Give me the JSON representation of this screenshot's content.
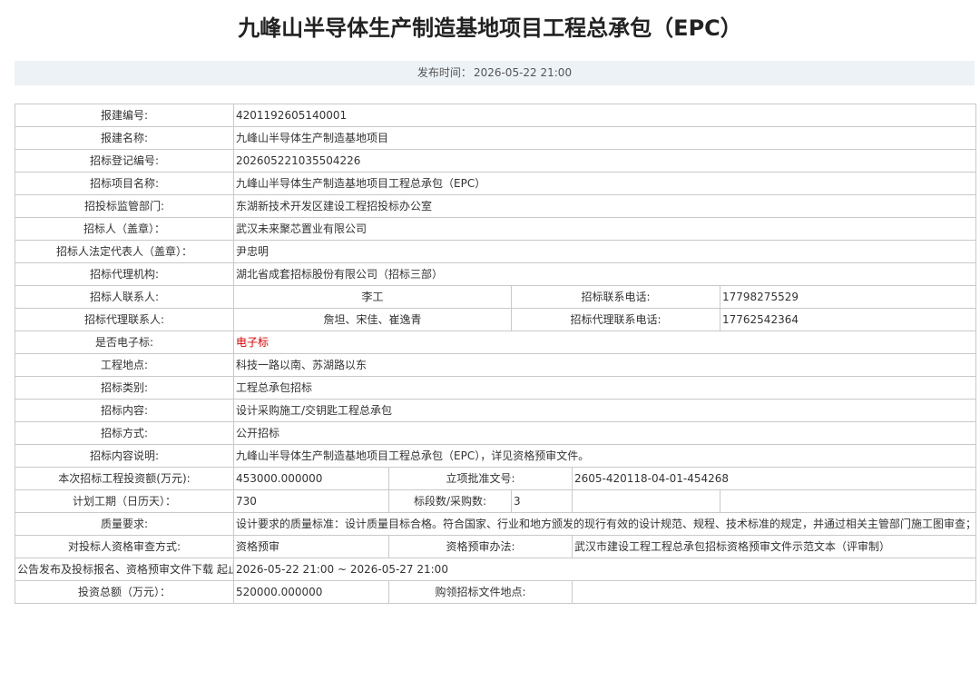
{
  "title": "九峰山半导体生产制造基地项目工程总承包（EPC）",
  "publish": {
    "label": "发布时间：",
    "value": "2026-05-22 21:00"
  },
  "rows": {
    "baojian_no": {
      "label": "报建编号:",
      "value": "4201192605140001"
    },
    "baojian_name": {
      "label": "报建名称:",
      "value": "九峰山半导体生产制造基地项目"
    },
    "zb_reg_no": {
      "label": "招标登记编号:",
      "value": "202605221035504226"
    },
    "zb_project_name": {
      "label": "招标项目名称:",
      "value": "九峰山半导体生产制造基地项目工程总承包（EPC）"
    },
    "supervisor": {
      "label": "招投标监管部门:",
      "value": "东湖新技术开发区建设工程招投标办公室"
    },
    "tenderer": {
      "label": "招标人（盖章）：",
      "value": "武汉未来聚芯置业有限公司"
    },
    "legal_rep": {
      "label": "招标人法定代表人（盖章）：",
      "value": "尹忠明"
    },
    "agency": {
      "label": "招标代理机构:",
      "value": "湖北省成套招标股份有限公司（招标三部）"
    },
    "contact": {
      "label": "招标人联系人:",
      "value": "李工",
      "phone_label": "招标联系电话:",
      "phone": "17798275529"
    },
    "agency_contact": {
      "label": "招标代理联系人:",
      "value": "詹坦、宋佳、崔逸青",
      "phone_label": "招标代理联系电话:",
      "phone": "17762542364"
    },
    "electronic": {
      "label": "是否电子标:",
      "value": "电子标"
    },
    "location": {
      "label": "工程地点:",
      "value": "科技一路以南、苏湖路以东"
    },
    "category": {
      "label": "招标类别:",
      "value": "工程总承包招标"
    },
    "content": {
      "label": "招标内容:",
      "value": "设计采购施工/交钥匙工程总承包"
    },
    "method": {
      "label": "招标方式:",
      "value": "公开招标"
    },
    "description": {
      "label": "招标内容说明:",
      "value": "九峰山半导体生产制造基地项目工程总承包（EPC），详见资格预审文件。"
    },
    "investment": {
      "label": "本次招标工程投资额(万元):",
      "value": "453000.000000",
      "approval_label": "立项批准文号:",
      "approval": "2605-420118-04-01-454268"
    },
    "duration": {
      "label": "计划工期（日历天）：",
      "value": "730",
      "sections_label": "标段数/采购数:",
      "sections": "3"
    },
    "quality": {
      "label": "质量要求:",
      "value": "设计要求的质量标准：设计质量目标合格。符合国家、行业和地方颁发的现行有效的设计规范、规程、技术标准的规定，并通过相关主管部门施工图审查；施工要求的质量标准：合格，达到国家施工验收规范合格标准。项目建设所涉及的各类材料、设施、设备、物资均需满足施工设计图纸与有关技术标准、规范的强制性要求。"
    },
    "review": {
      "label": "对投标人资格审查方式:",
      "value": "资格预审",
      "method_label": "资格预审办法:",
      "method": "武汉市建设工程工程总承包招标资格预审文件示范文本（评审制）"
    },
    "period": {
      "label": "公告发布及投标报名、资格预审文件下载 起止时间:",
      "value": "2026-05-22 21:00 ~ 2026-05-27 21:00"
    },
    "total_investment": {
      "label": "投资总额（万元）：",
      "value": "520000.000000",
      "place_label": "购领招标文件地点:",
      "place": ""
    }
  }
}
